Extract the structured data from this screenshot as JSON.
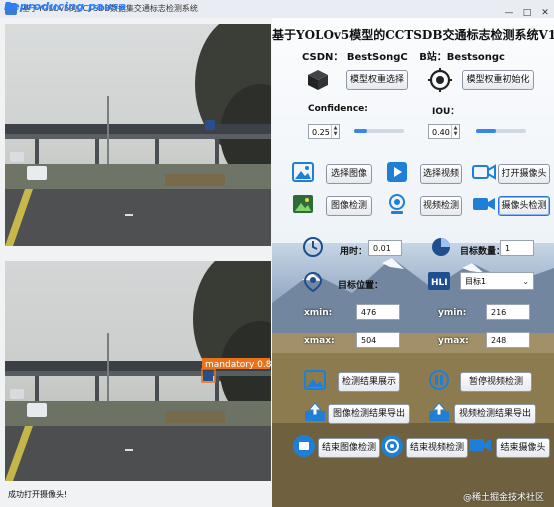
{
  "window": {
    "title": "基于YOLOv5的CCTSDB数据集交通标志检测系统",
    "recording_badge": "Reproducing pausa"
  },
  "header": {
    "title": "基于YOLOv5模型的CCTSDB交通标志检测系统V1.0",
    "csdn": "CSDN：  BestSongC",
    "bilibili": "B站：Bestsongc"
  },
  "model": {
    "select_label": "模型权重选择",
    "init_label": "模型权重初始化"
  },
  "params": {
    "confidence_label": "Confidence:",
    "confidence_value": "0.25",
    "confidence_slider": 0.25,
    "iou_label": "IOU：",
    "iou_value": "0.40",
    "iou_slider": 0.4
  },
  "actions": {
    "select_image": "选择图像",
    "select_video": "选择视频",
    "open_camera": "打开摄像头",
    "image_detect": "图像检测",
    "video_detect": "视频检测",
    "camera_detect": "摄像头检测"
  },
  "results": {
    "time_label": "用时：",
    "time_value": "0.01",
    "count_label": "目标数量：",
    "count_value": "1",
    "position_label": "目标位置：",
    "target_select": "目标1",
    "xmin_label": "xmin:",
    "xmin_value": "476",
    "ymin_label": "ymin:",
    "ymin_value": "216",
    "xmax_label": "xmax:",
    "xmax_value": "504",
    "ymax_label": "ymax:",
    "ymax_value": "248"
  },
  "bottom_actions": {
    "show_results": "检测结果展示",
    "pause_video": "暂停视频检测",
    "export_image": "图像检测结果导出",
    "export_video": "视频检测结果导出",
    "stop_image": "结束图像检测",
    "stop_video": "结束视频检测",
    "stop_camera": "结束摄像头"
  },
  "detection": {
    "label": "mandatory 0.8"
  },
  "status": {
    "message": "成功打开摄像头!"
  },
  "watermark": "@稀土掘金技术社区",
  "colors": {
    "accent": "#3a86e8",
    "box": "#e8731c"
  }
}
